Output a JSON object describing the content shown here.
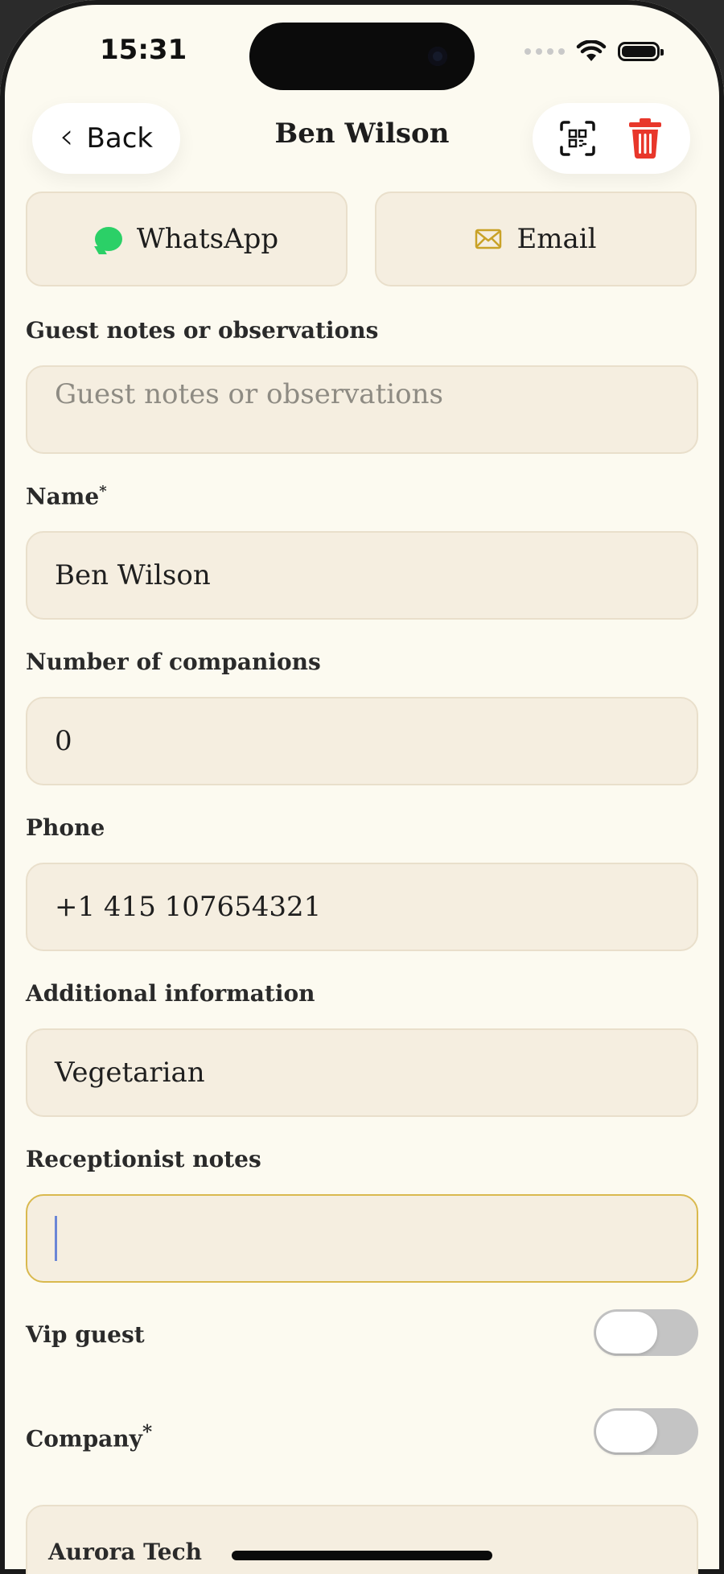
{
  "status_bar": {
    "time": "15:31"
  },
  "nav": {
    "back_label": "Back",
    "title": "Ben Wilson",
    "qr_icon": "qr-code-icon",
    "delete_icon": "trash-icon"
  },
  "contact": {
    "whatsapp_label": "WhatsApp",
    "email_label": "Email"
  },
  "form": {
    "guest_notes": {
      "label": "Guest notes or observations",
      "placeholder": "Guest notes or observations",
      "value": ""
    },
    "name": {
      "label": "Name",
      "required_mark": "*",
      "value": "Ben Wilson"
    },
    "companions": {
      "label": "Number of companions",
      "value": "0"
    },
    "phone": {
      "label": "Phone",
      "value": "+1 415 107654321"
    },
    "additional_info": {
      "label": "Additional information",
      "value": "Vegetarian"
    },
    "receptionist_notes": {
      "label": "Receptionist notes",
      "value": ""
    },
    "vip": {
      "label": "Vip guest",
      "on": false
    },
    "company": {
      "label": "Company",
      "required_mark": "*",
      "on": false,
      "value": "Aurora Tech"
    }
  },
  "colors": {
    "accent_focus": "#d9b94e",
    "whatsapp": "#2bd067",
    "delete": "#e8372b",
    "email_icon": "#c9a227",
    "background": "#fcfaf0",
    "field_bg": "#f5eee0"
  }
}
